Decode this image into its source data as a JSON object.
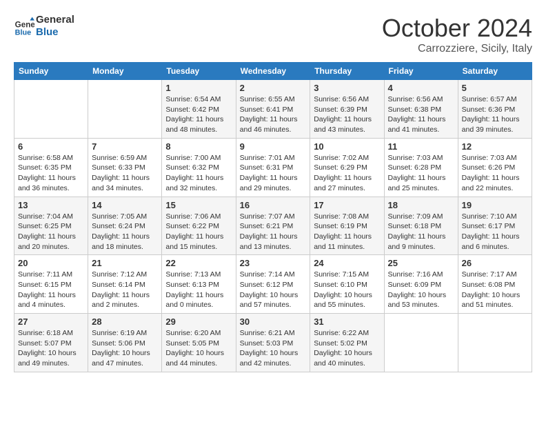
{
  "header": {
    "logo_line1": "General",
    "logo_line2": "Blue",
    "month": "October 2024",
    "location": "Carrozziere, Sicily, Italy"
  },
  "columns": [
    "Sunday",
    "Monday",
    "Tuesday",
    "Wednesday",
    "Thursday",
    "Friday",
    "Saturday"
  ],
  "weeks": [
    [
      {
        "day": "",
        "info": ""
      },
      {
        "day": "",
        "info": ""
      },
      {
        "day": "1",
        "info": "Sunrise: 6:54 AM\nSunset: 6:42 PM\nDaylight: 11 hours and 48 minutes."
      },
      {
        "day": "2",
        "info": "Sunrise: 6:55 AM\nSunset: 6:41 PM\nDaylight: 11 hours and 46 minutes."
      },
      {
        "day": "3",
        "info": "Sunrise: 6:56 AM\nSunset: 6:39 PM\nDaylight: 11 hours and 43 minutes."
      },
      {
        "day": "4",
        "info": "Sunrise: 6:56 AM\nSunset: 6:38 PM\nDaylight: 11 hours and 41 minutes."
      },
      {
        "day": "5",
        "info": "Sunrise: 6:57 AM\nSunset: 6:36 PM\nDaylight: 11 hours and 39 minutes."
      }
    ],
    [
      {
        "day": "6",
        "info": "Sunrise: 6:58 AM\nSunset: 6:35 PM\nDaylight: 11 hours and 36 minutes."
      },
      {
        "day": "7",
        "info": "Sunrise: 6:59 AM\nSunset: 6:33 PM\nDaylight: 11 hours and 34 minutes."
      },
      {
        "day": "8",
        "info": "Sunrise: 7:00 AM\nSunset: 6:32 PM\nDaylight: 11 hours and 32 minutes."
      },
      {
        "day": "9",
        "info": "Sunrise: 7:01 AM\nSunset: 6:31 PM\nDaylight: 11 hours and 29 minutes."
      },
      {
        "day": "10",
        "info": "Sunrise: 7:02 AM\nSunset: 6:29 PM\nDaylight: 11 hours and 27 minutes."
      },
      {
        "day": "11",
        "info": "Sunrise: 7:03 AM\nSunset: 6:28 PM\nDaylight: 11 hours and 25 minutes."
      },
      {
        "day": "12",
        "info": "Sunrise: 7:03 AM\nSunset: 6:26 PM\nDaylight: 11 hours and 22 minutes."
      }
    ],
    [
      {
        "day": "13",
        "info": "Sunrise: 7:04 AM\nSunset: 6:25 PM\nDaylight: 11 hours and 20 minutes."
      },
      {
        "day": "14",
        "info": "Sunrise: 7:05 AM\nSunset: 6:24 PM\nDaylight: 11 hours and 18 minutes."
      },
      {
        "day": "15",
        "info": "Sunrise: 7:06 AM\nSunset: 6:22 PM\nDaylight: 11 hours and 15 minutes."
      },
      {
        "day": "16",
        "info": "Sunrise: 7:07 AM\nSunset: 6:21 PM\nDaylight: 11 hours and 13 minutes."
      },
      {
        "day": "17",
        "info": "Sunrise: 7:08 AM\nSunset: 6:19 PM\nDaylight: 11 hours and 11 minutes."
      },
      {
        "day": "18",
        "info": "Sunrise: 7:09 AM\nSunset: 6:18 PM\nDaylight: 11 hours and 9 minutes."
      },
      {
        "day": "19",
        "info": "Sunrise: 7:10 AM\nSunset: 6:17 PM\nDaylight: 11 hours and 6 minutes."
      }
    ],
    [
      {
        "day": "20",
        "info": "Sunrise: 7:11 AM\nSunset: 6:15 PM\nDaylight: 11 hours and 4 minutes."
      },
      {
        "day": "21",
        "info": "Sunrise: 7:12 AM\nSunset: 6:14 PM\nDaylight: 11 hours and 2 minutes."
      },
      {
        "day": "22",
        "info": "Sunrise: 7:13 AM\nSunset: 6:13 PM\nDaylight: 11 hours and 0 minutes."
      },
      {
        "day": "23",
        "info": "Sunrise: 7:14 AM\nSunset: 6:12 PM\nDaylight: 10 hours and 57 minutes."
      },
      {
        "day": "24",
        "info": "Sunrise: 7:15 AM\nSunset: 6:10 PM\nDaylight: 10 hours and 55 minutes."
      },
      {
        "day": "25",
        "info": "Sunrise: 7:16 AM\nSunset: 6:09 PM\nDaylight: 10 hours and 53 minutes."
      },
      {
        "day": "26",
        "info": "Sunrise: 7:17 AM\nSunset: 6:08 PM\nDaylight: 10 hours and 51 minutes."
      }
    ],
    [
      {
        "day": "27",
        "info": "Sunrise: 6:18 AM\nSunset: 5:07 PM\nDaylight: 10 hours and 49 minutes."
      },
      {
        "day": "28",
        "info": "Sunrise: 6:19 AM\nSunset: 5:06 PM\nDaylight: 10 hours and 47 minutes."
      },
      {
        "day": "29",
        "info": "Sunrise: 6:20 AM\nSunset: 5:05 PM\nDaylight: 10 hours and 44 minutes."
      },
      {
        "day": "30",
        "info": "Sunrise: 6:21 AM\nSunset: 5:03 PM\nDaylight: 10 hours and 42 minutes."
      },
      {
        "day": "31",
        "info": "Sunrise: 6:22 AM\nSunset: 5:02 PM\nDaylight: 10 hours and 40 minutes."
      },
      {
        "day": "",
        "info": ""
      },
      {
        "day": "",
        "info": ""
      }
    ]
  ]
}
